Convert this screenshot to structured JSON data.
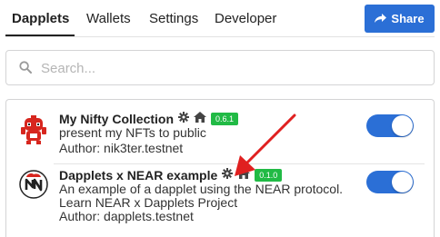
{
  "tabs": [
    {
      "label": "Dapplets",
      "active": true
    },
    {
      "label": "Wallets",
      "active": false
    },
    {
      "label": "Settings",
      "active": false
    },
    {
      "label": "Developer",
      "active": false
    }
  ],
  "share_button": {
    "label": "Share",
    "icon": "share-icon"
  },
  "search": {
    "placeholder": "Search...",
    "value": "",
    "icon": "search-icon"
  },
  "dapplets": [
    {
      "title": "My Nifty Collection",
      "version": "0.6.1",
      "description": "present my NFTs to public",
      "author": "Author: nik3ter.testnet",
      "enabled": true,
      "icons": [
        "gear-icon",
        "home-icon"
      ]
    },
    {
      "title": "Dapplets x NEAR example",
      "version": "0.1.0",
      "description": "An example of a dapplet using the NEAR protocol.",
      "description2": "Learn NEAR x Dapplets Project",
      "author": "Author: dapplets.testnet",
      "enabled": true,
      "icons": [
        "gear-icon",
        "home-icon"
      ]
    }
  ],
  "colors": {
    "accent": "#2b6fd6",
    "version_badge": "#21ba45",
    "annotation_arrow": "#e02020"
  }
}
